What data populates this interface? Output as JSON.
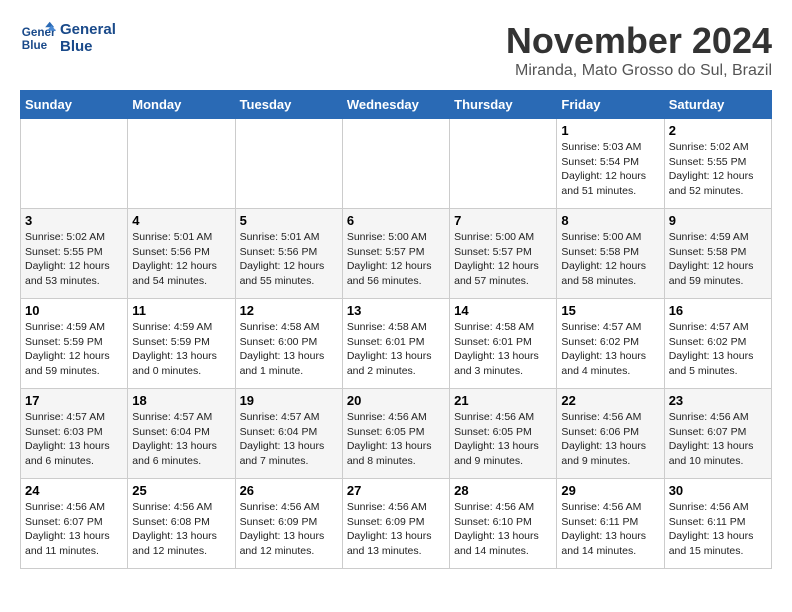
{
  "logo": {
    "line1": "General",
    "line2": "Blue"
  },
  "title": "November 2024",
  "location": "Miranda, Mato Grosso do Sul, Brazil",
  "weekdays": [
    "Sunday",
    "Monday",
    "Tuesday",
    "Wednesday",
    "Thursday",
    "Friday",
    "Saturday"
  ],
  "weeks": [
    [
      {
        "day": "",
        "info": ""
      },
      {
        "day": "",
        "info": ""
      },
      {
        "day": "",
        "info": ""
      },
      {
        "day": "",
        "info": ""
      },
      {
        "day": "",
        "info": ""
      },
      {
        "day": "1",
        "info": "Sunrise: 5:03 AM\nSunset: 5:54 PM\nDaylight: 12 hours\nand 51 minutes."
      },
      {
        "day": "2",
        "info": "Sunrise: 5:02 AM\nSunset: 5:55 PM\nDaylight: 12 hours\nand 52 minutes."
      }
    ],
    [
      {
        "day": "3",
        "info": "Sunrise: 5:02 AM\nSunset: 5:55 PM\nDaylight: 12 hours\nand 53 minutes."
      },
      {
        "day": "4",
        "info": "Sunrise: 5:01 AM\nSunset: 5:56 PM\nDaylight: 12 hours\nand 54 minutes."
      },
      {
        "day": "5",
        "info": "Sunrise: 5:01 AM\nSunset: 5:56 PM\nDaylight: 12 hours\nand 55 minutes."
      },
      {
        "day": "6",
        "info": "Sunrise: 5:00 AM\nSunset: 5:57 PM\nDaylight: 12 hours\nand 56 minutes."
      },
      {
        "day": "7",
        "info": "Sunrise: 5:00 AM\nSunset: 5:57 PM\nDaylight: 12 hours\nand 57 minutes."
      },
      {
        "day": "8",
        "info": "Sunrise: 5:00 AM\nSunset: 5:58 PM\nDaylight: 12 hours\nand 58 minutes."
      },
      {
        "day": "9",
        "info": "Sunrise: 4:59 AM\nSunset: 5:58 PM\nDaylight: 12 hours\nand 59 minutes."
      }
    ],
    [
      {
        "day": "10",
        "info": "Sunrise: 4:59 AM\nSunset: 5:59 PM\nDaylight: 12 hours\nand 59 minutes."
      },
      {
        "day": "11",
        "info": "Sunrise: 4:59 AM\nSunset: 5:59 PM\nDaylight: 13 hours\nand 0 minutes."
      },
      {
        "day": "12",
        "info": "Sunrise: 4:58 AM\nSunset: 6:00 PM\nDaylight: 13 hours\nand 1 minute."
      },
      {
        "day": "13",
        "info": "Sunrise: 4:58 AM\nSunset: 6:01 PM\nDaylight: 13 hours\nand 2 minutes."
      },
      {
        "day": "14",
        "info": "Sunrise: 4:58 AM\nSunset: 6:01 PM\nDaylight: 13 hours\nand 3 minutes."
      },
      {
        "day": "15",
        "info": "Sunrise: 4:57 AM\nSunset: 6:02 PM\nDaylight: 13 hours\nand 4 minutes."
      },
      {
        "day": "16",
        "info": "Sunrise: 4:57 AM\nSunset: 6:02 PM\nDaylight: 13 hours\nand 5 minutes."
      }
    ],
    [
      {
        "day": "17",
        "info": "Sunrise: 4:57 AM\nSunset: 6:03 PM\nDaylight: 13 hours\nand 6 minutes."
      },
      {
        "day": "18",
        "info": "Sunrise: 4:57 AM\nSunset: 6:04 PM\nDaylight: 13 hours\nand 6 minutes."
      },
      {
        "day": "19",
        "info": "Sunrise: 4:57 AM\nSunset: 6:04 PM\nDaylight: 13 hours\nand 7 minutes."
      },
      {
        "day": "20",
        "info": "Sunrise: 4:56 AM\nSunset: 6:05 PM\nDaylight: 13 hours\nand 8 minutes."
      },
      {
        "day": "21",
        "info": "Sunrise: 4:56 AM\nSunset: 6:05 PM\nDaylight: 13 hours\nand 9 minutes."
      },
      {
        "day": "22",
        "info": "Sunrise: 4:56 AM\nSunset: 6:06 PM\nDaylight: 13 hours\nand 9 minutes."
      },
      {
        "day": "23",
        "info": "Sunrise: 4:56 AM\nSunset: 6:07 PM\nDaylight: 13 hours\nand 10 minutes."
      }
    ],
    [
      {
        "day": "24",
        "info": "Sunrise: 4:56 AM\nSunset: 6:07 PM\nDaylight: 13 hours\nand 11 minutes."
      },
      {
        "day": "25",
        "info": "Sunrise: 4:56 AM\nSunset: 6:08 PM\nDaylight: 13 hours\nand 12 minutes."
      },
      {
        "day": "26",
        "info": "Sunrise: 4:56 AM\nSunset: 6:09 PM\nDaylight: 13 hours\nand 12 minutes."
      },
      {
        "day": "27",
        "info": "Sunrise: 4:56 AM\nSunset: 6:09 PM\nDaylight: 13 hours\nand 13 minutes."
      },
      {
        "day": "28",
        "info": "Sunrise: 4:56 AM\nSunset: 6:10 PM\nDaylight: 13 hours\nand 14 minutes."
      },
      {
        "day": "29",
        "info": "Sunrise: 4:56 AM\nSunset: 6:11 PM\nDaylight: 13 hours\nand 14 minutes."
      },
      {
        "day": "30",
        "info": "Sunrise: 4:56 AM\nSunset: 6:11 PM\nDaylight: 13 hours\nand 15 minutes."
      }
    ]
  ]
}
